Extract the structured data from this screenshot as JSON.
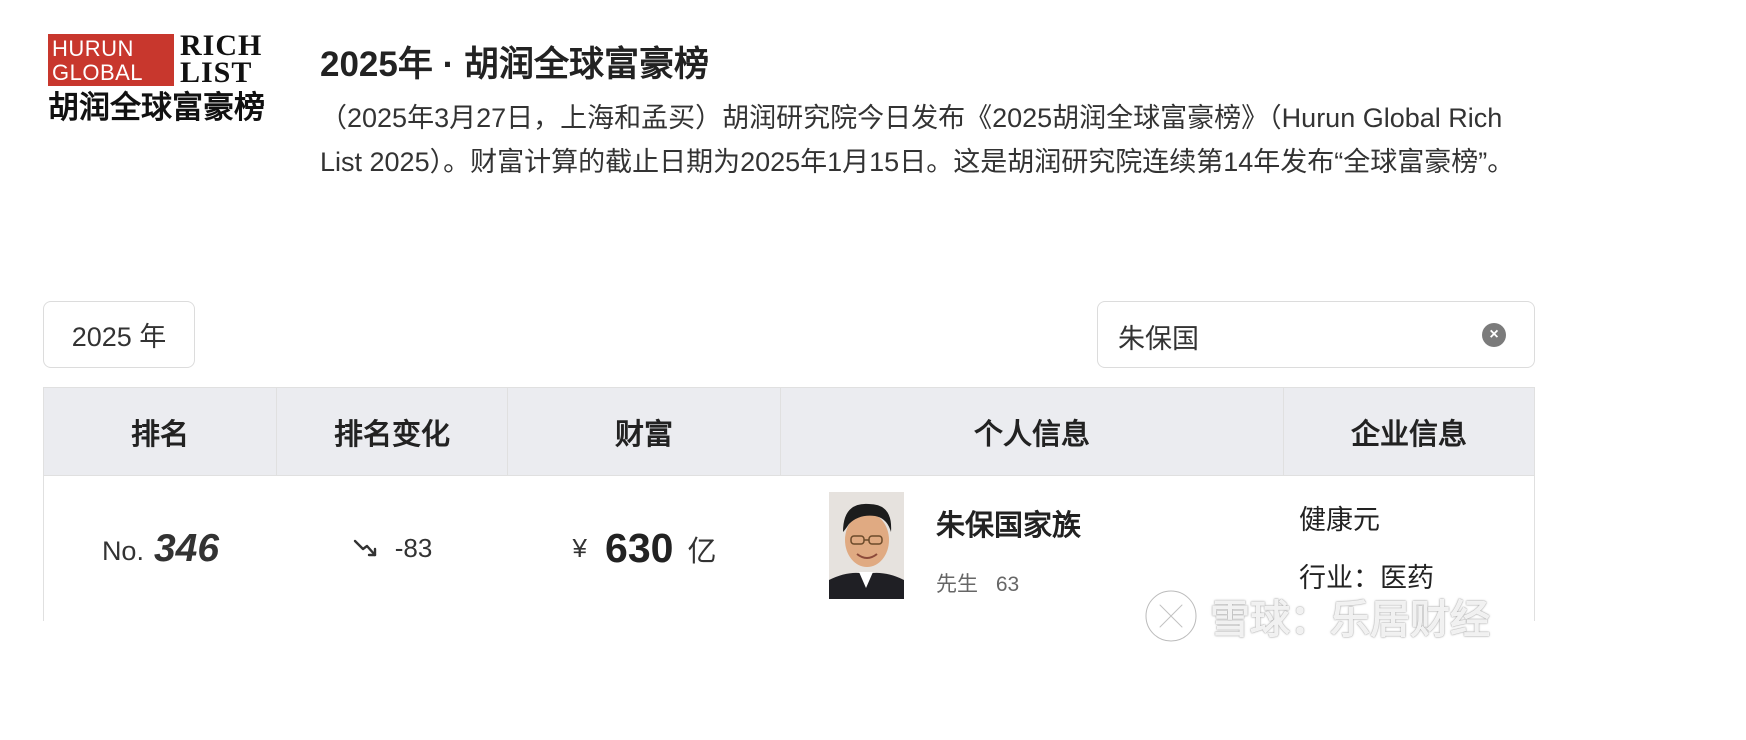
{
  "logo": {
    "line1": "HURUN",
    "line2": "GLOBAL",
    "line3": "RICH",
    "line4": "LIST",
    "cn": "胡润全球富豪榜"
  },
  "header": {
    "title": "2025年 · 胡润全球富豪榜",
    "description": "（2025年3月27日，上海和孟买）胡润研究院今日发布《2025胡润全球富豪榜》（Hurun Global Rich List 2025）。财富计算的截止日期为2025年1月15日。这是胡润研究院连续第14年发布“全球富豪榜”。"
  },
  "filters": {
    "year": "2025 年",
    "search_value": "朱保国"
  },
  "table": {
    "headers": [
      "排名",
      "排名变化",
      "财富",
      "个人信息",
      "企业信息"
    ],
    "rows": [
      {
        "rank_prefix": "No.",
        "rank": "346",
        "change": "-83",
        "currency": "¥",
        "wealth": "630",
        "wealth_unit": "亿",
        "name": "朱保国家族",
        "title": "先生",
        "age": "63",
        "company": "健康元",
        "industry": "行业：医药"
      }
    ]
  },
  "watermark": "雪球：乐居财经",
  "colors": {
    "brand_red": "#c8372d",
    "header_bg": "#ebecf0",
    "border": "#e0e0e0"
  }
}
